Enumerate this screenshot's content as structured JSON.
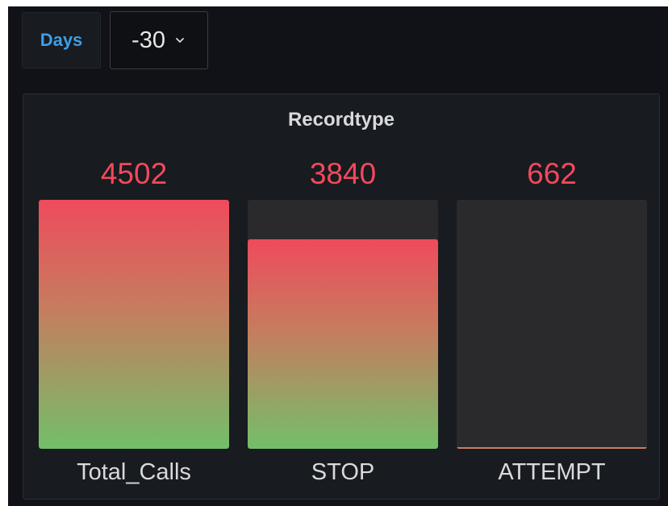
{
  "variables": {
    "days_label": "Days",
    "days_value": "-30",
    "dropdown_icon": "chevron-down-icon"
  },
  "panel": {
    "title": "Recordtype"
  },
  "colors": {
    "value_text": "#f2495c",
    "gradient_top": "#ef4b5c",
    "gradient_bottom": "#73bf69",
    "variable_label": "#3d9ee8",
    "background": "#111217",
    "panel": "#181b1f"
  },
  "chart_data": {
    "type": "bar",
    "title": "Recordtype",
    "categories": [
      "Total_Calls",
      "STOP",
      "ATTEMPT"
    ],
    "values": [
      4502,
      3840,
      662
    ],
    "value_labels": [
      "4502",
      "3840",
      "662"
    ],
    "fill_fractions": [
      1.0,
      0.84,
      0.005
    ]
  }
}
